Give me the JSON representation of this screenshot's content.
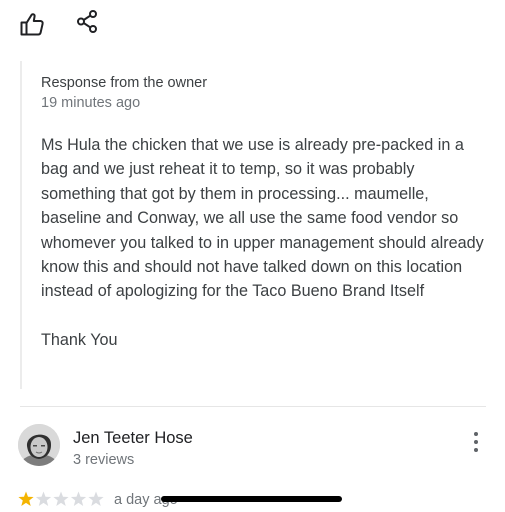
{
  "owner_response": {
    "label": "Response from the owner",
    "time": "19 minutes ago",
    "text": "Ms Hula the chicken that we use is already pre-packed in a bag and we just reheat it to temp, so it was probably something that got by them in processing... maumelle, baseline and Conway, we all use the same food vendor so whomever you talked to in upper management should already know this and should not have talked down on this location instead of apologizing for the Taco Bueno Brand Itself\n\nThank You"
  },
  "actions": {
    "like_icon": "thumbs-up-icon",
    "share_icon": "share-icon"
  },
  "review": {
    "reviewer_name": "Jen Teeter Hose",
    "reviewer_review_count": "3 reviews",
    "rating": 1,
    "rating_max": 5,
    "time": "a day ago",
    "more_icon": "more-vertical-icon"
  },
  "colors": {
    "star_filled": "#F4B400",
    "star_empty": "#DADCE0",
    "text_primary": "#202124",
    "text_secondary": "#70757A"
  }
}
